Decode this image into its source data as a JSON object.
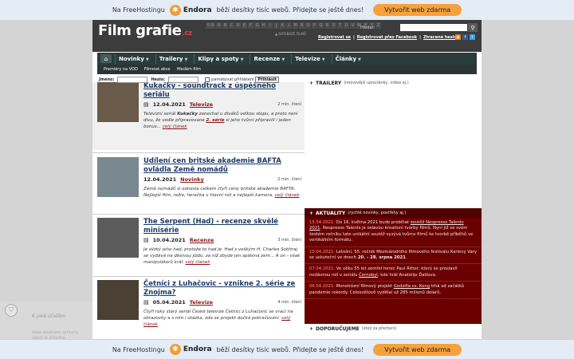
{
  "hostbar": {
    "prefix": "Na FreeHostingu",
    "brand": "Endora",
    "message": "běží desítky tisíc webů. Přidejte se ještě dnes!",
    "cta": "Vytvořit web zdarma"
  },
  "header": {
    "logo": "Film grafie",
    "logo_suffix": ".cz",
    "alphabet": [
      "0-9",
      "A",
      "B",
      "C",
      "D",
      "E",
      "F",
      "G",
      "H",
      "I",
      "J",
      "K",
      "L",
      "M",
      "N",
      "O",
      "P",
      "Q",
      "R",
      "S",
      "T",
      "U",
      "V",
      "W",
      "X",
      "Y",
      "Z"
    ],
    "database_label": "DATABÁZE FILMŮ",
    "search_label": "Hledat:",
    "search_placeholder": "",
    "links": [
      "Registrovat se",
      "Registrovat přes Facebook",
      "Ztracené heslo"
    ],
    "social": [
      {
        "icon": "rss-icon",
        "color": "#e8801c"
      },
      {
        "icon": "facebook-icon",
        "color": "#3b5998"
      },
      {
        "icon": "twitter-icon",
        "color": "#3aa2de"
      }
    ]
  },
  "nav": {
    "items": [
      "Novinky",
      "Trailery",
      "Klipy a spoty",
      "Recenze",
      "Televize",
      "Články"
    ],
    "subitems": [
      "Premiéry na VOD",
      "Filmové akce",
      "Hledám film"
    ]
  },
  "login": {
    "name_label": "Jméno:",
    "password_label": "Heslo:",
    "remember_label": "pamatovat přihlášení",
    "submit": "Přihlásit"
  },
  "articles": [
    {
      "title": "Kukačky - soundtrack z úspěšného seriálu",
      "date": "12.04.2021",
      "category": "Televize",
      "read_time": "2 min. čtení",
      "text_pre": "Televizní seriál ",
      "text_bold": "Kukačky",
      "text_mid": " zanechal u diváků velkou stopu, a proto není divu, že vedle připravované ",
      "text_link": "2. série",
      "text_post": " si jeho tvůrci připravili i jeden bonus...",
      "more": "celý článek",
      "thumb_color": "#6a5a4a"
    },
    {
      "title": "Udílení cen britské akademie BAFTA ovládla Země nomádů",
      "date": "12.04.2021",
      "category": "Novinky",
      "read_time": "2 min. čtení",
      "text_pre": "Země nomádů si odnesla celkem čtyři ceny britské akademie BAFTA. Nejlepší film, režie, herečka v hlavní roli a nejlepší kamera.",
      "text_bold": "",
      "text_mid": "",
      "text_link": "",
      "text_post": "",
      "more": "celý článek",
      "thumb_color": "#7a8890"
    },
    {
      "title": "The Serpent (Had) - recenze skvělé minisérie",
      "date": "10.04.2021",
      "category": "Recenze",
      "read_time": "3 min. čtení",
      "text_pre": "Je slizký jeho had, protože to had je. Had s veškým H. Charles Sobhraj se vydává na děsivou jízdu, za níž zbyde jen spálená zem... A on - však manipulátorů král.",
      "text_bold": "",
      "text_mid": "",
      "text_link": "",
      "text_post": "",
      "more": "celý článek",
      "thumb_color": "#5c5c5c"
    },
    {
      "title": "Četníci z Luhačovic - vznikne 2. série ze Znojma?",
      "date": "05.04.2021",
      "category": "Televize",
      "read_time": "4 min. čtení",
      "text_pre": "Čtyři roky starý seriál České televize Četníci z Luhačovic se vrací na obrazovky a s ním i otázka, zda se projekt dočká pokračování.",
      "text_bold": "",
      "text_mid": "",
      "text_link": "",
      "text_post": "",
      "more": "celý článek",
      "thumb_color": "#4a4034"
    }
  ],
  "sidebar": {
    "trailers_title": "TRAILERY",
    "trailers_sub": "(nejnovější upoutávky, videa aj.)",
    "news_title": "AKTUALITY",
    "news_sub": "(rychlé novinky, postřehy aj.)",
    "news": [
      {
        "date": "15.04.2021:",
        "pre": " Do 16. května 2021 bude probíhat ",
        "link": "soutěž Nespresso Talents 2021",
        "post": ". Nespresso Talents je oslavou kreativní tvorby filmů. Nyní již ve svém šestém ročníku tato unikátní soutěž vyzývá tvůrce filmů ke tvorbě příběhů ve vertikálním formátu.",
        "bold": ""
      },
      {
        "date": "10.04.2021:",
        "pre": " Letošní, 55. ročník Mezinárodního filmového festivalu Karlovy Vary se uskuteční ve dnech ",
        "link": "",
        "post": ".",
        "bold": "20. - 28. srpna 2021"
      },
      {
        "date": "07.04.2021:",
        "pre": " Ve věku 55 let zemřel herec Paul Ritter, který se proslavil nedávnou rolí v seriálu ",
        "link": "Černobyl",
        "post": ", kde hrál Anatolije Ďatlova.",
        "bold": ""
      },
      {
        "date": "06.04.2021:",
        "pre": " Monstrózní filmový projekt ",
        "link": "Godzilla vs. Kong",
        "post": " trhá od začátků pandemie rekordy. Celosvětově vydělal už 285 milionů dolarů.",
        "bold": ""
      }
    ],
    "reco_title": "DOPORUČUJEME",
    "reco_sub": "(stojí za přečtení)"
  },
  "cookie": {
    "title": "K jaké účelům",
    "text": "Vaše soukromí ochrany údajů je důležité."
  },
  "colors": {
    "header_bg": "#3c3c3c",
    "nav_bg": "#2a3c3c",
    "news_bg": "#6b0000",
    "link": "#1b3a66",
    "accent": "#8c1010",
    "hostbar_btn": "#f6a13c"
  }
}
